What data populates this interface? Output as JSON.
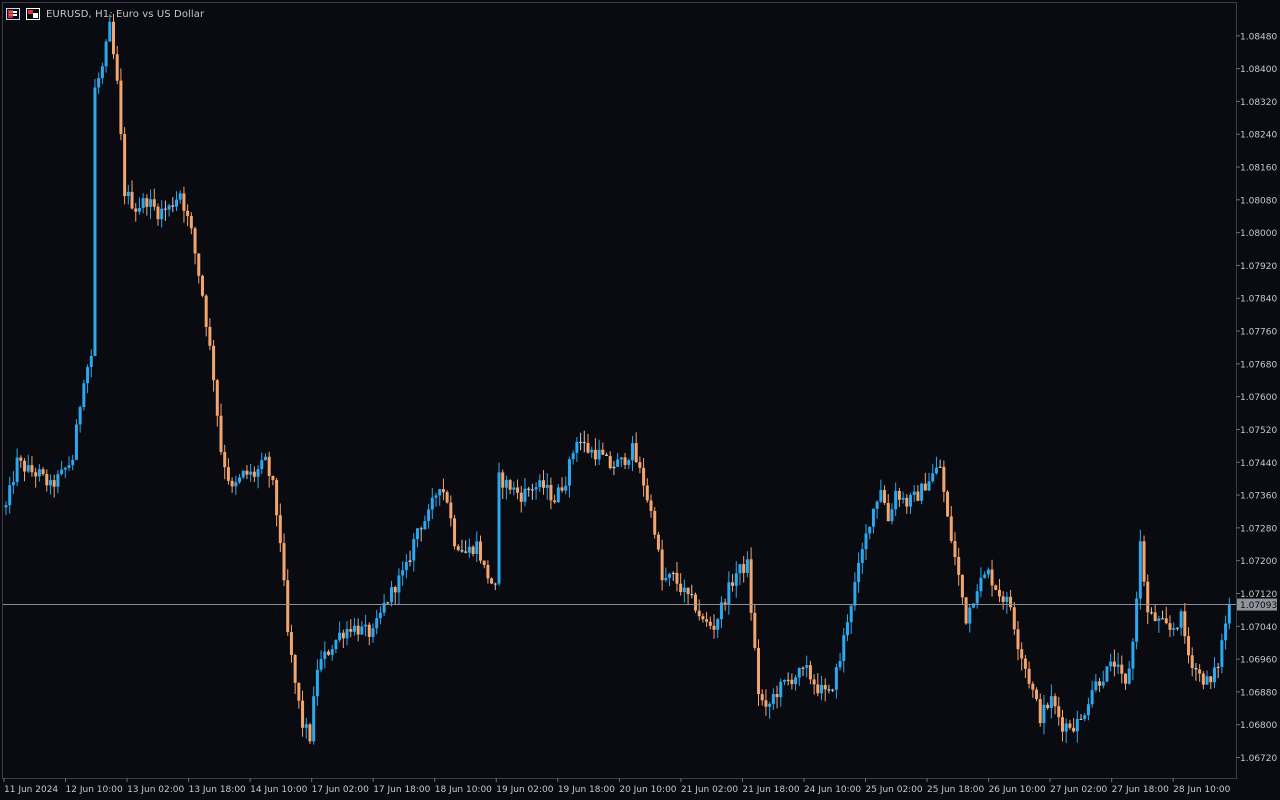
{
  "window": {
    "title": "EURUSD, H1:  Euro vs US Dollar"
  },
  "colors": {
    "background": "#0a0b10",
    "bull": "#2ba8f0",
    "bear": "#f2a66e",
    "doji": "#c9c9c9",
    "grid_text": "#c8c8c8",
    "bid_line": "#8a8f99",
    "price_tag_bg": "#8f939b"
  },
  "chart_data": {
    "type": "candlestick",
    "symbol": "EURUSD",
    "timeframe": "H1",
    "title": "EURUSD, H1:  Euro vs US Dollar",
    "ylim": [
      1.0667,
      1.0856
    ],
    "y_ticks": [
      "1.08480",
      "1.08400",
      "1.08320",
      "1.08240",
      "1.08160",
      "1.08080",
      "1.08000",
      "1.07920",
      "1.07840",
      "1.07760",
      "1.07680",
      "1.07600",
      "1.07520",
      "1.07440",
      "1.07360",
      "1.07280",
      "1.07200",
      "1.07120",
      "1.07040",
      "1.06960",
      "1.06880",
      "1.06800",
      "1.06720"
    ],
    "x_ticks": [
      "11 Jun 2024",
      "12 Jun 10:00",
      "13 Jun 02:00",
      "13 Jun 18:00",
      "14 Jun 10:00",
      "17 Jun 02:00",
      "17 Jun 18:00",
      "18 Jun 10:00",
      "19 Jun 02:00",
      "19 Jun 18:00",
      "20 Jun 10:00",
      "21 Jun 02:00",
      "21 Jun 18:00",
      "24 Jun 10:00",
      "25 Jun 02:00",
      "25 Jun 18:00",
      "26 Jun 10:00",
      "27 Jun 02:00",
      "27 Jun 18:00",
      "28 Jun 10:00"
    ],
    "current_price": "1.07093",
    "current_price_value": 1.07093,
    "ohlc_anchors": [
      [
        0,
        1.0733
      ],
      [
        3,
        1.0744
      ],
      [
        6,
        1.0742
      ],
      [
        9,
        1.0741
      ],
      [
        12,
        1.0738
      ],
      [
        15,
        1.0741
      ],
      [
        18,
        1.0745
      ],
      [
        21,
        1.0765
      ],
      [
        23,
        1.077
      ],
      [
        24,
        1.0835
      ],
      [
        26,
        1.084
      ],
      [
        28,
        1.085
      ],
      [
        30,
        1.0836
      ],
      [
        32,
        1.081
      ],
      [
        35,
        1.0806
      ],
      [
        38,
        1.0808
      ],
      [
        41,
        1.0805
      ],
      [
        44,
        1.0806
      ],
      [
        47,
        1.081
      ],
      [
        50,
        1.08
      ],
      [
        53,
        1.0785
      ],
      [
        56,
        1.0765
      ],
      [
        58,
        1.0747
      ],
      [
        61,
        1.0737
      ],
      [
        64,
        1.0741
      ],
      [
        67,
        1.0741
      ],
      [
        70,
        1.0744
      ],
      [
        72,
        1.0738
      ],
      [
        74,
        1.0725
      ],
      [
        76,
        1.0702
      ],
      [
        78,
        1.069
      ],
      [
        80,
        1.068
      ],
      [
        82,
        1.0677
      ],
      [
        84,
        1.0694
      ],
      [
        87,
        1.0698
      ],
      [
        90,
        1.0702
      ],
      [
        93,
        1.0704
      ],
      [
        96,
        1.0703
      ],
      [
        99,
        1.0702
      ],
      [
        102,
        1.0709
      ],
      [
        105,
        1.0714
      ],
      [
        108,
        1.0718
      ],
      [
        111,
        1.0728
      ],
      [
        114,
        1.0731
      ],
      [
        117,
        1.0739
      ],
      [
        119,
        1.0735
      ],
      [
        121,
        1.0725
      ],
      [
        124,
        1.0722
      ],
      [
        127,
        1.0724
      ],
      [
        129,
        1.0718
      ],
      [
        132,
        1.0713
      ],
      [
        133,
        1.074
      ],
      [
        136,
        1.0738
      ],
      [
        139,
        1.0736
      ],
      [
        142,
        1.0738
      ],
      [
        145,
        1.0738
      ],
      [
        148,
        1.0735
      ],
      [
        151,
        1.074
      ],
      [
        154,
        1.075
      ],
      [
        157,
        1.0747
      ],
      [
        160,
        1.0746
      ],
      [
        163,
        1.0743
      ],
      [
        166,
        1.0744
      ],
      [
        169,
        1.0747
      ],
      [
        172,
        1.0739
      ],
      [
        175,
        1.0728
      ],
      [
        177,
        1.0715
      ],
      [
        180,
        1.0716
      ],
      [
        183,
        1.0712
      ],
      [
        186,
        1.0709
      ],
      [
        188,
        1.0705
      ],
      [
        191,
        1.0704
      ],
      [
        194,
        1.0711
      ],
      [
        197,
        1.0717
      ],
      [
        200,
        1.0719
      ],
      [
        201,
        1.0708
      ],
      [
        203,
        1.0688
      ],
      [
        205,
        1.0683
      ],
      [
        207,
        1.0687
      ],
      [
        210,
        1.069
      ],
      [
        213,
        1.0692
      ],
      [
        216,
        1.0693
      ],
      [
        219,
        1.0689
      ],
      [
        222,
        1.0687
      ],
      [
        225,
        1.0696
      ],
      [
        227,
        1.0706
      ],
      [
        230,
        1.0718
      ],
      [
        233,
        1.073
      ],
      [
        236,
        1.0738
      ],
      [
        238,
        1.073
      ],
      [
        240,
        1.0737
      ],
      [
        243,
        1.0734
      ],
      [
        246,
        1.0736
      ],
      [
        249,
        1.074
      ],
      [
        252,
        1.0743
      ],
      [
        254,
        1.073
      ],
      [
        257,
        1.0716
      ],
      [
        259,
        1.0706
      ],
      [
        262,
        1.0714
      ],
      [
        265,
        1.0717
      ],
      [
        268,
        1.0712
      ],
      [
        271,
        1.0709
      ],
      [
        273,
        1.07
      ],
      [
        275,
        1.0694
      ],
      [
        277,
        1.0688
      ],
      [
        279,
        1.0682
      ],
      [
        282,
        1.0686
      ],
      [
        285,
        1.068
      ],
      [
        288,
        1.068
      ],
      [
        290,
        1.0681
      ],
      [
        293,
        1.0689
      ],
      [
        296,
        1.0692
      ],
      [
        299,
        1.0695
      ],
      [
        302,
        1.0689
      ],
      [
        304,
        1.07
      ],
      [
        306,
        1.0724
      ],
      [
        308,
        1.0707
      ],
      [
        311,
        1.0705
      ],
      [
        314,
        1.0703
      ],
      [
        317,
        1.0706
      ],
      [
        319,
        1.0697
      ],
      [
        322,
        1.0692
      ],
      [
        325,
        1.069
      ],
      [
        327,
        1.0695
      ],
      [
        329,
        1.0705
      ],
      [
        330,
        1.0709
      ]
    ]
  }
}
